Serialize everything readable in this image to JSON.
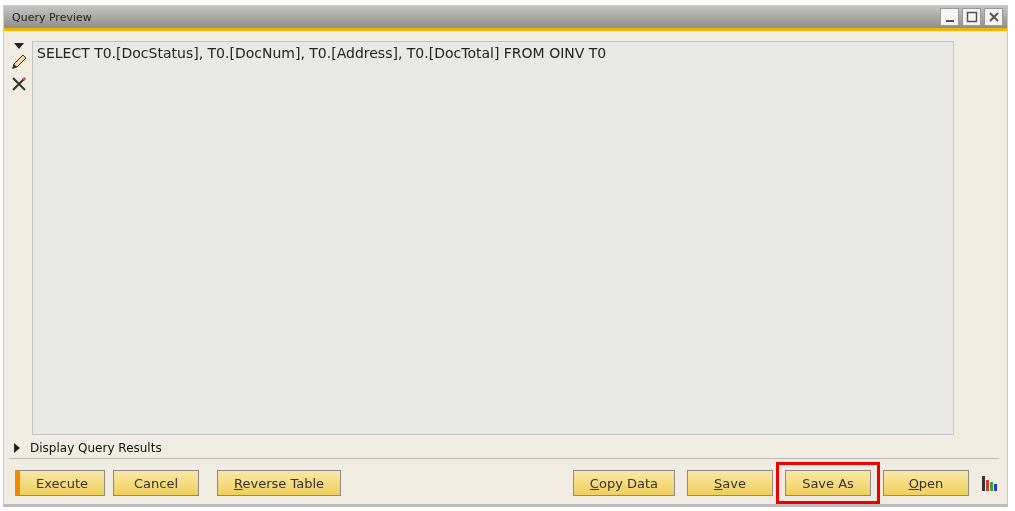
{
  "window": {
    "title": "Query Preview"
  },
  "query": {
    "value": "SELECT T0.[DocStatus], T0.[DocNum], T0.[Address], T0.[DocTotal] FROM OINV T0"
  },
  "results_toggle": {
    "label": "Display Query Results",
    "expanded": false
  },
  "left_buttons": [
    {
      "label": "Execute",
      "mnemonic": false,
      "default": true,
      "highlighted": false
    },
    {
      "label": "Cancel",
      "mnemonic": false,
      "default": false,
      "highlighted": false
    },
    {
      "label": "Reverse Table",
      "mnemonic": true,
      "default": false,
      "highlighted": false
    }
  ],
  "right_buttons": [
    {
      "label": "Copy Data",
      "mnemonic": true,
      "default": false,
      "highlighted": false
    },
    {
      "label": "Save",
      "mnemonic": true,
      "default": false,
      "highlighted": false
    },
    {
      "label": "Save As",
      "mnemonic": false,
      "default": false,
      "highlighted": true
    },
    {
      "label": "Open",
      "mnemonic": true,
      "default": false,
      "highlighted": false
    }
  ]
}
